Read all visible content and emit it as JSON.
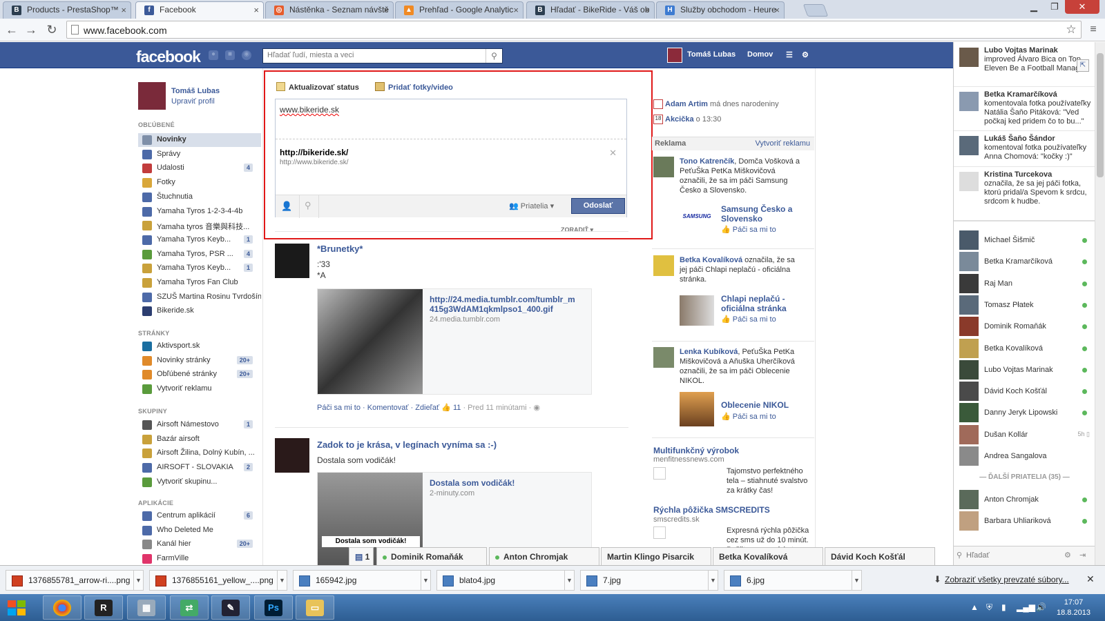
{
  "browser": {
    "tabs": [
      {
        "title": "Products - PrestaShop™",
        "color": "#2c3e50",
        "glyph": "B"
      },
      {
        "title": "Facebook",
        "color": "#3b5998",
        "glyph": "f"
      },
      {
        "title": "Nástěnka - Seznam návště",
        "color": "#e65c2c",
        "glyph": "◎"
      },
      {
        "title": "Prehľad - Google Analytic",
        "color": "#f08a24",
        "glyph": "▲"
      },
      {
        "title": "Hľadať - BikeRide - Váš ob",
        "color": "#2c3e50",
        "glyph": "B"
      },
      {
        "title": "Služby obchodom - Heure",
        "color": "#3d7bd1",
        "glyph": "H"
      }
    ],
    "url": "www.facebook.com"
  },
  "fb": {
    "logo": "facebook",
    "search_placeholder": "Hľadať ľudí, miesta a veci",
    "user_name": "Tomáš Lubas",
    "home": "Domov",
    "profile_name": "Tomáš Lubas",
    "edit_profile": "Upraviť profil",
    "sections": {
      "favorites": "OBĽÚBENÉ",
      "pages": "STRÁNKY",
      "groups": "SKUPINY",
      "apps": "APLIKÁCIE"
    },
    "favorites": [
      {
        "label": "Novinky",
        "badge": "",
        "color": "#7f8fa8"
      },
      {
        "label": "Správy",
        "badge": "",
        "color": "#4d6aa8"
      },
      {
        "label": "Udalosti",
        "badge": "4",
        "color": "#c23c3c"
      },
      {
        "label": "Fotky",
        "badge": "",
        "color": "#d9a73a"
      },
      {
        "label": "Štuchnutia",
        "badge": "",
        "color": "#4d6aa8"
      },
      {
        "label": "Yamaha Tyros 1-2-3-4-4b",
        "badge": "",
        "color": "#4d6aa8"
      },
      {
        "label": "Yamaha tyros 音樂與科技...",
        "badge": "",
        "color": "#c9a13b"
      },
      {
        "label": "Yamaha Tyros Keyb...",
        "badge": "1",
        "color": "#4d6aa8"
      },
      {
        "label": "Yamaha Tyros, PSR ...",
        "badge": "4",
        "color": "#5a9b3c"
      },
      {
        "label": "Yamaha Tyros Keyb...",
        "badge": "1",
        "color": "#c9a13b"
      },
      {
        "label": "Yamaha Tyros Fan Club",
        "badge": "",
        "color": "#c9a13b"
      },
      {
        "label": "SZUŠ Martina Rosinu Tvrdošín",
        "badge": "",
        "color": "#4d6aa8"
      },
      {
        "label": "Bikeride.sk",
        "badge": "",
        "color": "#2c3e70"
      }
    ],
    "pages": [
      {
        "label": "Aktivsport.sk",
        "badge": "",
        "color": "#1a6ea0"
      },
      {
        "label": "Novinky stránky",
        "badge": "20+",
        "color": "#e08a2a"
      },
      {
        "label": "Obľúbené stránky",
        "badge": "20+",
        "color": "#e08a2a"
      },
      {
        "label": "Vytvoriť reklamu",
        "badge": "",
        "color": "#5a9b3c"
      }
    ],
    "groups": [
      {
        "label": "Airsoft Námestovo",
        "badge": "1",
        "color": "#555555"
      },
      {
        "label": "Bazár airsoft",
        "badge": "",
        "color": "#c9a13b"
      },
      {
        "label": "Airsoft Žilina, Dolný Kubín, ...",
        "badge": "",
        "color": "#c9a13b"
      },
      {
        "label": "AIRSOFT - SLOVAKIA",
        "badge": "2",
        "color": "#4d6aa8"
      },
      {
        "label": "Vytvoriť skupinu...",
        "badge": "",
        "color": "#5a9b3c"
      }
    ],
    "apps": [
      {
        "label": "Centrum aplikácií",
        "badge": "6",
        "color": "#4d6aa8"
      },
      {
        "label": "Who Deleted Me",
        "badge": "",
        "color": "#4d6aa8"
      },
      {
        "label": "Kanál hier",
        "badge": "20+",
        "color": "#888888"
      },
      {
        "label": "FarmVille",
        "badge": "",
        "color": "#e0346a"
      }
    ],
    "composer": {
      "tab_status": "Aktualizovať status",
      "tab_photo": "Pridať fotky/video",
      "text": "www.bikeride.sk",
      "link_title": "http://bikeride.sk/",
      "link_url": "http://www.bikeride.sk/",
      "audience": "Priatelia",
      "send": "Odoslať",
      "sort": "ZORADIŤ"
    },
    "posts": [
      {
        "title": "*Brunetky*",
        "text1": ":'33",
        "text2": "*A",
        "att_link": "http://24.media.tumblr.com/tumblr_m415g3WdAM1qkmlpso1_400.gif",
        "att_src": "24.media.tumblr.com",
        "footer": "Páči sa mi to · Komentovať · Zdieľať",
        "likes": "11",
        "time": "· Pred 11 minútami ·"
      },
      {
        "title": "Zadok to je krása, v legínach vyníma sa :-)",
        "text1": "Dostala som vodičák!",
        "att_link": "Dostala som vodičák!",
        "att_src": "2-minuty.com",
        "caption": "Dostala som vodičák!"
      }
    ],
    "events": [
      {
        "name": "Adam Artim",
        "rest": "má dnes narodeniny"
      },
      {
        "name": "Akcička",
        "rest": "o 13:30"
      }
    ],
    "ads_header": "Reklama",
    "create_ad": "Vytvoriť reklamu",
    "ads": [
      {
        "text_bold": "Tono Katrenčík",
        "text": ", Domča Vošková a PeťuŠka PetKa Miškovičová označili, že sa im páči Samsung Česko a Slovensko.",
        "page": "Samsung Česko a Slovensko",
        "like": "Páči sa mi to"
      },
      {
        "text_bold": "Betka Kovalíková",
        "text": " označila, že sa jej páči Chlapi neplačú - oficiálna stránka.",
        "page": "Chlapi neplačú - oficiálna stránka",
        "like": "Páči sa mi to"
      },
      {
        "text_bold": "Lenka Kubíková",
        "text": ", PeťuŠka PetKa Miškovičová a Aňuška Uherčíková označili, že sa im páči Oblecenie NIKOL.",
        "page": "Oblecenie NIKOL",
        "like": "Páči sa mi to"
      }
    ],
    "sponsored": [
      {
        "title": "Multifunkčný výrobok",
        "domain": "menfitnessnews.com",
        "desc": "Tajomstvo perfektného tela – stiahnuté svalstvo za krátky čas!"
      },
      {
        "title": "Rýchla pôžička SMSCREDITS",
        "domain": "smscredits.sk",
        "desc": "Expresná rýchla pôžička cez sms už do 10 minút. Pošlite sms a získate"
      }
    ],
    "samsung_logo": "SAMSUNG"
  },
  "ticker": [
    {
      "name": "Lubo Vojtas Marinak",
      "text": "improved Álvaro Bica on Top Eleven Be a Football Manager."
    },
    {
      "name": "Betka Kramarčíková",
      "text": "komentovala fotka používateľky Natália Šaňo Pitáková: \"Ved počkaj ked pridem čo to bu...\""
    },
    {
      "name": "Lukáš Šaňo Šándor",
      "text": "komentoval fotka používateľky Anna Chomová: \"kočky :)\""
    },
    {
      "name": "Kristina Turcekova",
      "text": "označila, že sa jej páči fotka, ktorú pridal/a Spevom k srdcu, srdcom k hudbe."
    }
  ],
  "chat": [
    {
      "name": "Michael Šišmič",
      "status": "online"
    },
    {
      "name": "Betka Kramarčíková",
      "status": "online"
    },
    {
      "name": "Raj Man",
      "status": "online"
    },
    {
      "name": "Tomasz Płatek",
      "status": "online"
    },
    {
      "name": "Dominik Romaňák",
      "status": "online"
    },
    {
      "name": "Betka Kovalíková",
      "status": "online"
    },
    {
      "name": "Lubo Vojtas Marinak",
      "status": "online"
    },
    {
      "name": "Dávid Koch Košťál",
      "status": "online"
    },
    {
      "name": "Danny Jeryk Lipowski",
      "status": "online"
    },
    {
      "name": "Dušan Kollár",
      "status": "5h"
    },
    {
      "name": "Andrea Sangalova",
      "status": ""
    }
  ],
  "chat_more": "ĎALŠÍ PRIATELIA (35)",
  "chat_more_list": [
    {
      "name": "Anton Chromjak",
      "status": "online"
    },
    {
      "name": "Barbara Uhliariková",
      "status": "online"
    }
  ],
  "chat_search": "Hľadať",
  "chat_tabs": [
    {
      "label": "1",
      "online": false
    },
    {
      "label": "Dominik Romaňák",
      "online": true
    },
    {
      "label": "Anton Chromjak",
      "online": true
    },
    {
      "label": "Martin Klingo Pisarcik",
      "online": false
    },
    {
      "label": "Betka Kovalíková",
      "online": false
    },
    {
      "label": "Dávid Koch Košťál",
      "online": false
    }
  ],
  "downloads": [
    {
      "name": "1376855781_arrow-ri....png"
    },
    {
      "name": "1376855161_yellow_....png"
    },
    {
      "name": "165942.jpg"
    },
    {
      "name": "blato4.jpg"
    },
    {
      "name": "7.jpg"
    },
    {
      "name": "6.jpg"
    }
  ],
  "downloads_all": "Zobraziť všetky prevzaté súbory...",
  "clock": {
    "time": "17:07",
    "date": "18.8.2013"
  }
}
